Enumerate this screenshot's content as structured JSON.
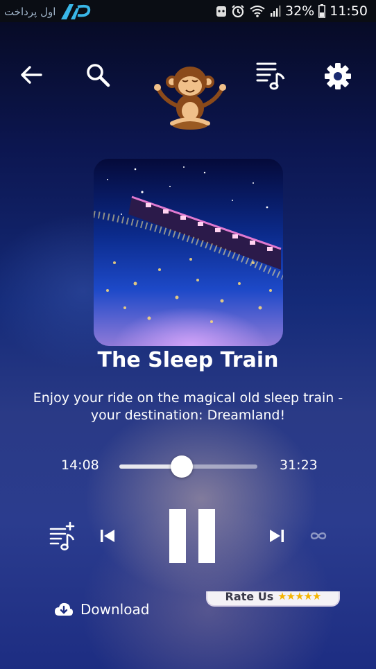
{
  "status_bar": {
    "brand_text": "اول پرداخت",
    "battery": "32%",
    "time": "11:50"
  },
  "toolbar": {
    "back_icon": "arrow-left-icon",
    "search_icon": "search-icon",
    "playlist_icon": "playlist-icon",
    "settings_icon": "gear-icon"
  },
  "track": {
    "title": "The Sleep Train",
    "description": "Enjoy your ride on the magical old sleep train - your destination: Dreamland!",
    "current_time": "14:08",
    "total_time": "31:23",
    "progress": 0.45
  },
  "controls": {
    "add_to_playlist_icon": "playlist-add-icon",
    "previous_icon": "skip-previous-icon",
    "pause_icon": "pause-icon",
    "next_icon": "skip-next-icon",
    "loop_icon": "infinity-icon"
  },
  "footer": {
    "download_label": "Download",
    "rate_label": "Rate Us",
    "rate_stars": "★★★★★"
  }
}
